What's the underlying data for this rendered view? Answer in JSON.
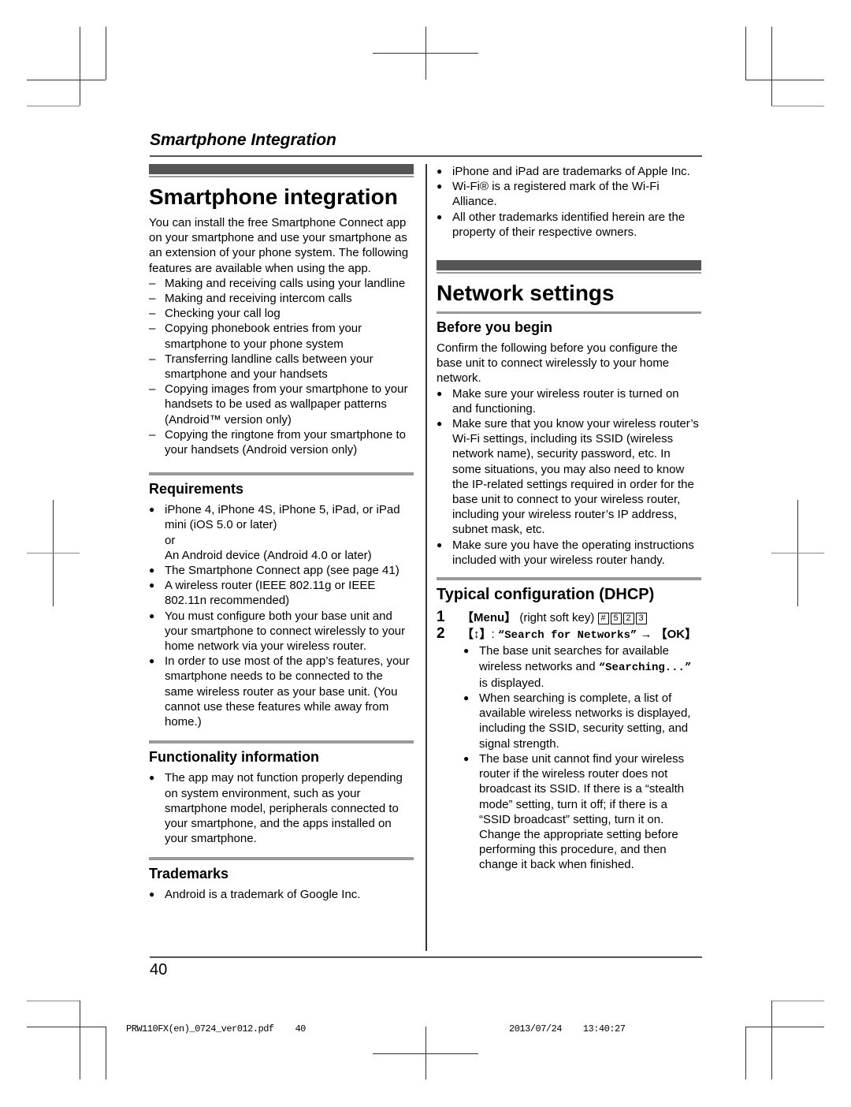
{
  "running_header": "Smartphone Integration",
  "left": {
    "title": "Smartphone integration",
    "intro": "You can install the free Smartphone Connect app on your smartphone and use your smartphone as an extension of your phone system. The following features are available when using the app.",
    "features": [
      "Making and receiving calls using your landline",
      "Making and receiving intercom calls",
      "Checking your call log",
      "Copying phonebook entries from your smartphone to your phone system",
      "Transferring landline calls between your smartphone and your handsets",
      "Copying images from your smartphone to your handsets to be used as wallpaper patterns (Android™ version only)",
      "Copying the ringtone from your smartphone to your handsets (Android version only)"
    ],
    "requirements": {
      "heading": "Requirements",
      "item1": "iPhone 4, iPhone 4S, iPhone 5, iPad, or iPad mini (iOS 5.0 or later)",
      "item1_or": "or",
      "item1_alt": "An Android device (Android 4.0 or later)",
      "item2": "The Smartphone Connect app (see page 41)",
      "item3": "A wireless router (IEEE 802.11g or IEEE 802.11n recommended)",
      "item4": "You must configure both your base unit and your smartphone to connect wirelessly to your home network via your wireless router.",
      "item5": "In order to use most of the app’s features, your smartphone needs to be connected to the same wireless router as your base unit. (You cannot use these features while away from home.)"
    },
    "functionality": {
      "heading": "Functionality information",
      "item1": "The app may not function properly depending on system environment, such as your smartphone model, peripherals connected to your smartphone, and the apps installed on your smartphone."
    },
    "trademarks": {
      "heading": "Trademarks",
      "item1": "Android is a trademark of Google Inc."
    }
  },
  "right": {
    "trademarks_cont": [
      "iPhone and iPad are trademarks of Apple Inc.",
      "Wi-Fi® is a registered mark of the Wi-Fi Alliance.",
      "All other trademarks identified herein are the property of their respective owners."
    ],
    "title": "Network settings",
    "before": {
      "heading": "Before you begin",
      "intro": "Confirm the following before you configure the base unit to connect wirelessly to your home network.",
      "items": [
        "Make sure your wireless router is turned on and functioning.",
        "Make sure that you know your wireless router’s Wi-Fi settings, including its SSID (wireless network name), security password, etc. In some situations, you may also need to know the IP-related settings required in order for the base unit to connect to your wireless router, including your wireless router’s IP address, subnet mask, etc.",
        "Make sure you have the operating instructions included with your wireless router handy."
      ]
    },
    "dhcp": {
      "heading": "Typical configuration (DHCP)",
      "step1_num": "1",
      "step1_key": "【Menu】",
      "step1_text": " (right soft key) ",
      "step1_keys": [
        "#",
        "5",
        "2",
        "3"
      ],
      "step2_num": "2",
      "step2_key": "【↕】",
      "step2_sep": ": ",
      "step2_menu": "“Search for Networks”",
      "step2_arrow": " → ",
      "step2_ok": "【OK】",
      "step2_items": [
        {
          "pre": "The base unit searches for available wireless networks and ",
          "mono": "“Searching...”",
          "post": " is displayed."
        },
        {
          "pre": "When searching is complete, a list of available wireless networks is displayed, including the SSID, security setting, and signal strength.",
          "mono": "",
          "post": ""
        },
        {
          "pre": "The base unit cannot find your wireless router if the wireless router does not broadcast its SSID. If there is a “stealth mode” setting, turn it off; if there is a “SSID broadcast” setting, turn it on. Change the appropriate setting before performing this procedure, and then change it back when finished.",
          "mono": "",
          "post": ""
        }
      ]
    }
  },
  "footer": {
    "page_number": "40",
    "print_file": "PRW110FX(en)_0724_ver012.pdf    40",
    "print_date": "2013/07/24    13:40:27"
  }
}
